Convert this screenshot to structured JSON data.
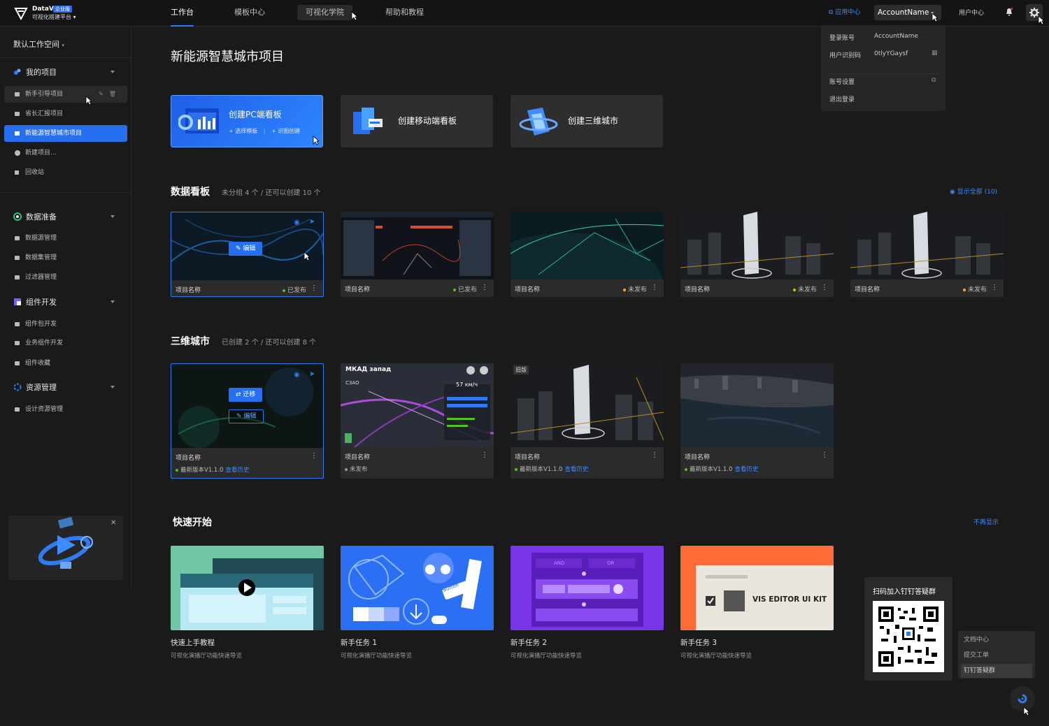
{
  "header": {
    "logo_title": "DataV",
    "logo_badge": "企业版",
    "logo_subtitle": "可视化搭建平台",
    "tabs": [
      "工作台",
      "模板中心",
      "可视化学院",
      "帮助和教程"
    ],
    "app_center": "应用中心",
    "account": "AccountName",
    "user_center": "用户中心"
  },
  "account_menu": {
    "login_label": "登录账号",
    "login_value": "AccountName",
    "uid_label": "用户识别码",
    "uid_value": "0tlyYGaysf",
    "settings": "账号设置",
    "logout": "退出登录"
  },
  "sidebar": {
    "workspace": "默认工作空间",
    "groups": [
      {
        "label": "我的项目",
        "items": [
          "新手引导项目",
          "省长汇报项目",
          "新能源智慧城市项目",
          "新建项目...",
          "回收站"
        ]
      },
      {
        "label": "数据准备",
        "items": [
          "数据源管理",
          "数据集管理",
          "过滤器管理"
        ]
      },
      {
        "label": "组件开发",
        "items": [
          "组件包开发",
          "业务组件开发",
          "组件收藏"
        ]
      },
      {
        "label": "资源管理",
        "items": [
          "设计资源管理"
        ]
      }
    ]
  },
  "main": {
    "title": "新能源智慧城市项目",
    "create": [
      {
        "label": "创建PC端看板",
        "sub1": "+ 选择模板",
        "sub2": "+ 识图创建"
      },
      {
        "label": "创建移动端看板"
      },
      {
        "label": "创建三维城市"
      }
    ],
    "boards": {
      "title": "数据看板",
      "subtitle": "未分组 4 个 / 还可以创建 10 个",
      "show_all": "显示全部 (10)",
      "edit_label": "编辑",
      "items": [
        {
          "name": "项目名称",
          "status": "已发布",
          "status_color": "#52c41a"
        },
        {
          "name": "项目名称",
          "status": "已发布",
          "status_color": "#52c41a"
        },
        {
          "name": "项目名称",
          "status": "未发布",
          "status_color": "#faad14"
        },
        {
          "name": "项目名称",
          "status": "未发布",
          "status_color": "#faad14"
        },
        {
          "name": "项目名称",
          "status": "未发布",
          "status_color": "#faad14"
        }
      ]
    },
    "cities": {
      "title": "三维城市",
      "subtitle": "已创建 2 个 / 还可以创建 8 个",
      "migrate_label": "迁移",
      "edit_label": "编辑",
      "old_tag": "旧版",
      "thumb2_title": "МКАД запад",
      "thumb2_sub": "СЗАО",
      "thumb2_speed": "57 км/ч",
      "items": [
        {
          "name": "项目名称",
          "version": "最新版本V1.1.0",
          "history": "查看历史"
        },
        {
          "name": "项目名称",
          "version": "未发布",
          "history": ""
        },
        {
          "name": "项目名称",
          "version": "最新版本V1.1.0",
          "history": "查看历史"
        },
        {
          "name": "项目名称",
          "version": "最新版本V1.1.0",
          "history": "查看历史"
        }
      ]
    },
    "quickstart": {
      "title": "快速开始",
      "hide": "不再显示",
      "uikit_label": "VIS EDITOR UI KIT",
      "btn_label": "Button",
      "items": [
        {
          "title": "快速上手教程",
          "desc": "可视化演播厅功能快速导览"
        },
        {
          "title": "新手任务 1",
          "desc": "可视化演播厅功能快速导览"
        },
        {
          "title": "新手任务 2",
          "desc": "可视化演播厅功能快速导览"
        },
        {
          "title": "新手任务 3",
          "desc": "可视化演播厅功能快速导览"
        }
      ]
    }
  },
  "qr": {
    "title": "扫码加入钉钉答疑群"
  },
  "help_menu": [
    "文档中心",
    "提交工单",
    "钉钉答疑群"
  ],
  "colors": {
    "accent": "#2670f0",
    "link": "#3e8cff"
  }
}
